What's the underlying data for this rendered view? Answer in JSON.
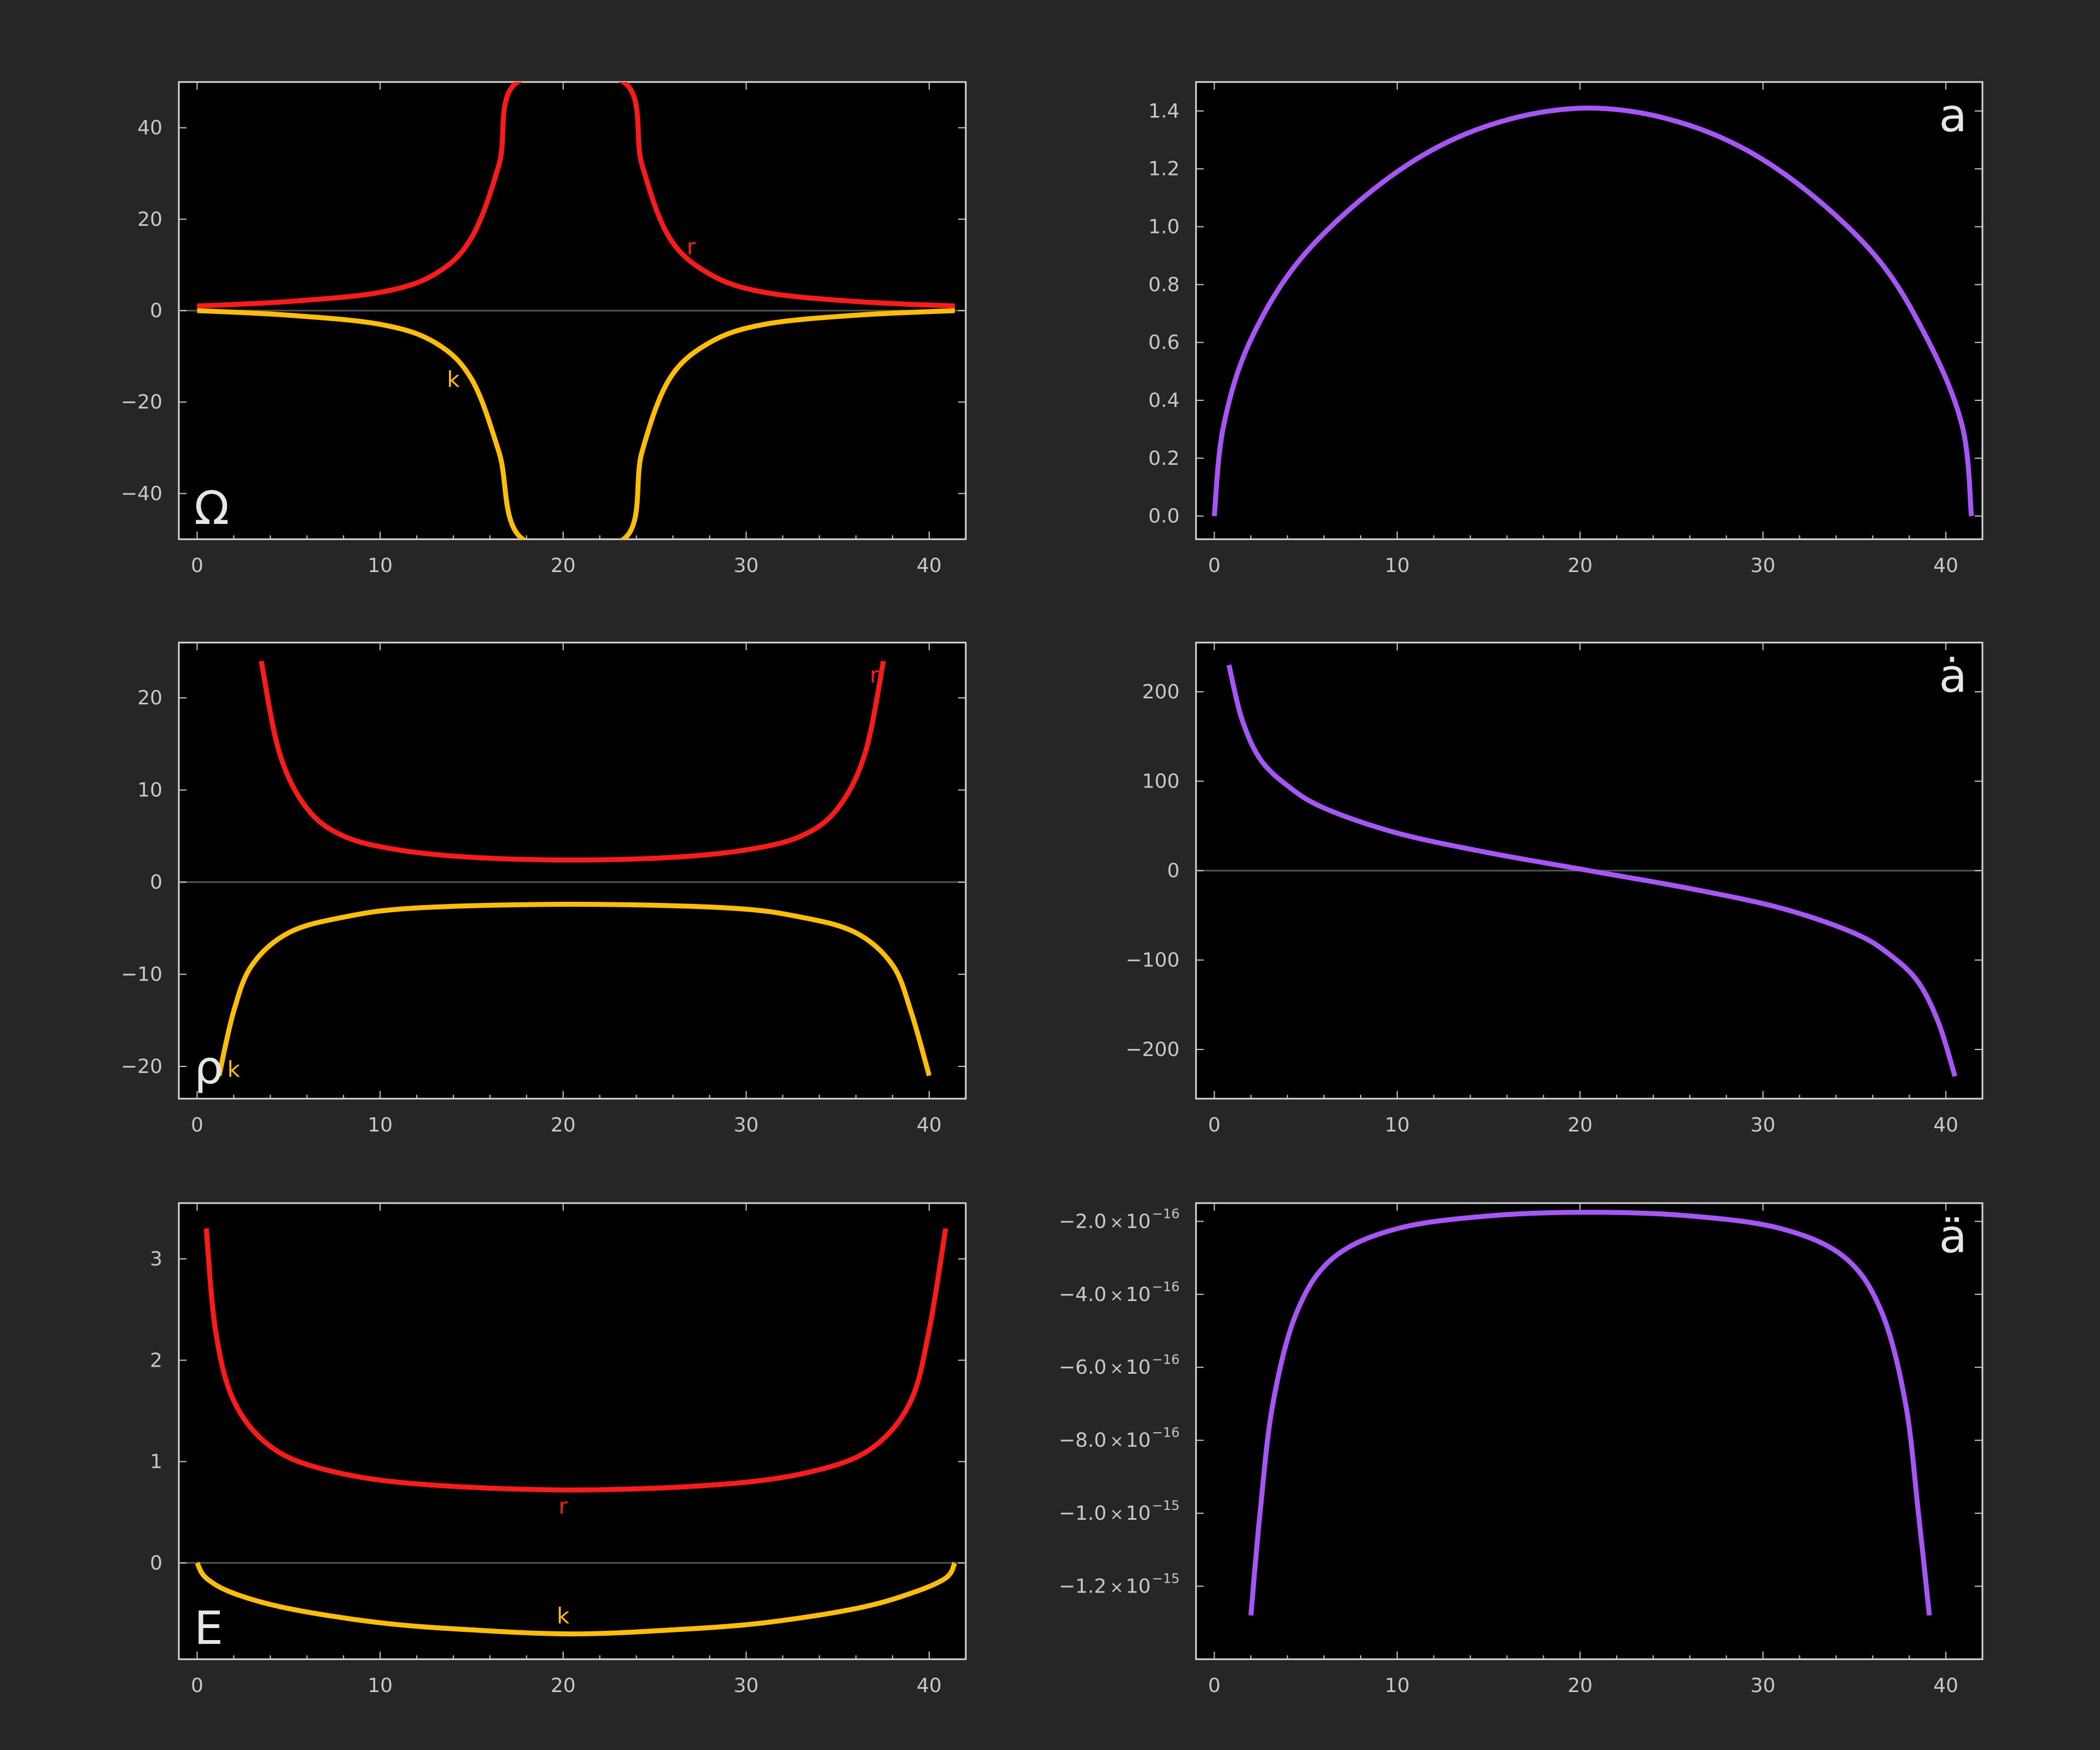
{
  "chart_data": [
    {
      "type": "line",
      "panel_label": "Ω",
      "xlim": [
        -1,
        42
      ],
      "ylim": [
        -50,
        50
      ],
      "x_ticks": [
        0,
        10,
        20,
        30,
        40
      ],
      "y_ticks": [
        40,
        20,
        0,
        -20,
        -40
      ],
      "y_tick_labels": [
        "40",
        "20",
        "0",
        "−20",
        "−40"
      ],
      "zero_line": true,
      "series": [
        {
          "name": "r",
          "color": "#ff1a1a",
          "x": [
            0,
            5,
            10,
            13,
            15,
            16.5,
            17.5,
            23.3,
            24.3,
            25.8,
            28,
            31,
            36,
            41.4
          ],
          "y": [
            1.0,
            2.0,
            4.0,
            8.0,
            16.0,
            32.0,
            50.0,
            50.0,
            32.0,
            16.0,
            8.0,
            4.0,
            2.0,
            1.0
          ]
        },
        {
          "name": "k",
          "color": "#ffbf00",
          "x": [
            0,
            5,
            10,
            13,
            15,
            16.5,
            17.8,
            23.3,
            24.3,
            25.8,
            28,
            31,
            36,
            41.4
          ],
          "y": [
            0,
            -1.0,
            -3.0,
            -7.0,
            -15.0,
            -31.0,
            -50.0,
            -50.0,
            -31.0,
            -15.0,
            -7.0,
            -3.0,
            -1.0,
            0
          ]
        }
      ],
      "annotations": [
        {
          "text": "r",
          "series": "r",
          "x": 27,
          "y": 14
        },
        {
          "text": "k",
          "series": "k",
          "x": 14,
          "y": -15
        }
      ]
    },
    {
      "type": "line",
      "panel_label": "a",
      "xlim": [
        -1,
        42
      ],
      "ylim": [
        -0.08,
        1.5
      ],
      "x_ticks": [
        0,
        10,
        20,
        30,
        40
      ],
      "y_ticks": [
        0,
        0.2,
        0.4,
        0.6,
        0.8,
        1.0,
        1.2,
        1.4
      ],
      "y_tick_labels": [
        "0.0",
        "0.2",
        "0.4",
        "0.6",
        "0.8",
        "1.0",
        "1.2",
        "1.4"
      ],
      "series": [
        {
          "name": "",
          "color": "#a855f7",
          "x": [
            0,
            0.5,
            2,
            5,
            10,
            15,
            20.5,
            26,
            31,
            36,
            39,
            40.9,
            41.4
          ],
          "y": [
            0,
            0.31,
            0.61,
            0.91,
            1.19,
            1.35,
            1.41,
            1.35,
            1.19,
            0.91,
            0.61,
            0.31,
            0
          ]
        }
      ]
    },
    {
      "type": "line",
      "panel_label": "ρ",
      "xlim": [
        -1,
        42
      ],
      "ylim": [
        -23.5,
        26
      ],
      "x_ticks": [
        0,
        10,
        20,
        30,
        40
      ],
      "y_ticks": [
        20,
        10,
        0,
        -10,
        -20
      ],
      "y_tick_labels": [
        "20",
        "10",
        "0",
        "−10",
        "−20"
      ],
      "zero_line": true,
      "series": [
        {
          "name": "r",
          "color": "#ff1a1a",
          "x": [
            3.5,
            4.5,
            6,
            8,
            11,
            15,
            20.5,
            26,
            30,
            33,
            35,
            36.5,
            37.5
          ],
          "y": [
            24,
            14,
            8,
            5,
            3.5,
            2.7,
            2.4,
            2.7,
            3.5,
            5,
            8,
            14,
            24
          ]
        },
        {
          "name": "k",
          "color": "#ffbf00",
          "x": [
            1.2,
            2,
            3,
            5,
            8,
            12,
            20.5,
            29,
            33,
            36,
            38,
            39,
            40
          ],
          "y": [
            -21,
            -14,
            -9,
            -5.5,
            -3.8,
            -2.8,
            -2.4,
            -2.8,
            -3.8,
            -5.5,
            -9,
            -14,
            -21
          ]
        }
      ],
      "annotations": [
        {
          "text": "r",
          "series": "r",
          "x": 37,
          "y": 22.5
        },
        {
          "text": "k",
          "series": "k",
          "x": 2,
          "y": -20.3
        }
      ]
    },
    {
      "type": "line",
      "panel_label": "ȧ",
      "xlim": [
        -1,
        42
      ],
      "ylim": [
        -255,
        255
      ],
      "x_ticks": [
        0,
        10,
        20,
        30,
        40
      ],
      "y_ticks": [
        200,
        100,
        0,
        -100,
        -200
      ],
      "y_tick_labels": [
        "200",
        "100",
        "0",
        "−100",
        "−200"
      ],
      "zero_line": true,
      "series": [
        {
          "name": "",
          "color": "#a855f7",
          "x": [
            0.8,
            1.5,
            2.5,
            4,
            6,
            10,
            15,
            20.5,
            26,
            31,
            35,
            37,
            38.5,
            39.6,
            40.5
          ],
          "y": [
            230,
            170,
            125,
            95,
            70,
            42,
            20,
            0,
            -20,
            -42,
            -70,
            -95,
            -125,
            -170,
            -230
          ]
        }
      ]
    },
    {
      "type": "line",
      "panel_label": "E",
      "xlim": [
        -1,
        42
      ],
      "ylim": [
        -0.95,
        3.55
      ],
      "x_ticks": [
        0,
        10,
        20,
        30,
        40
      ],
      "y_ticks": [
        3,
        2,
        1,
        0
      ],
      "y_tick_labels": [
        "3",
        "2",
        "1",
        "0"
      ],
      "zero_line": true,
      "series": [
        {
          "name": "r",
          "color": "#ff1a1a",
          "x": [
            0.5,
            1,
            2,
            4,
            7,
            12,
            20.5,
            29,
            34,
            37,
            39,
            40,
            40.9
          ],
          "y": [
            3.3,
            2.3,
            1.6,
            1.15,
            0.92,
            0.78,
            0.72,
            0.78,
            0.92,
            1.15,
            1.6,
            2.3,
            3.3
          ]
        },
        {
          "name": "k",
          "color": "#ffbf00",
          "x": [
            0,
            0.5,
            2,
            5,
            10,
            15,
            20.5,
            26,
            31,
            36,
            39,
            40.9,
            41.4
          ],
          "y": [
            0,
            -0.15,
            -0.3,
            -0.45,
            -0.59,
            -0.66,
            -0.7,
            -0.66,
            -0.59,
            -0.45,
            -0.3,
            -0.15,
            0
          ]
        }
      ],
      "annotations": [
        {
          "text": "r",
          "series": "r",
          "x": 20,
          "y": 0.56
        },
        {
          "text": "k",
          "series": "k",
          "x": 20,
          "y": -0.52
        }
      ]
    },
    {
      "type": "line",
      "panel_label": "ä",
      "xlim": [
        -1,
        42
      ],
      "ylim": [
        -1.4e-15,
        -1.5e-16
      ],
      "x_ticks": [
        0,
        10,
        20,
        30,
        40
      ],
      "y_ticks": [
        -2e-16,
        -4e-16,
        -6e-16,
        -8e-16,
        -1e-15,
        -1.2e-15
      ],
      "y_tick_labels": [
        {
          "mantissa": "−2.0",
          "times": "×",
          "base": "10",
          "exponent": "−16"
        },
        {
          "mantissa": "−4.0",
          "times": "×",
          "base": "10",
          "exponent": "−16"
        },
        {
          "mantissa": "−6.0",
          "times": "×",
          "base": "10",
          "exponent": "−16"
        },
        {
          "mantissa": "−8.0",
          "times": "×",
          "base": "10",
          "exponent": "−16"
        },
        {
          "mantissa": "−1.0",
          "times": "×",
          "base": "10",
          "exponent": "−15"
        },
        {
          "mantissa": "−1.2",
          "times": "×",
          "base": "10",
          "exponent": "−15"
        }
      ],
      "series": [
        {
          "name": "",
          "color": "#a855f7",
          "x": [
            2,
            2.5,
            3.2,
            4.5,
            6.5,
            10,
            15,
            20.5,
            26,
            31,
            34.5,
            36.5,
            37.8,
            38.5,
            39.1
          ],
          "y": [
            -1.28e-15,
            -1e-15,
            -7e-16,
            -4.5e-16,
            -3e-16,
            -2.2e-16,
            -1.85e-16,
            -1.75e-16,
            -1.85e-16,
            -2.2e-16,
            -3e-16,
            -4.5e-16,
            -7e-16,
            -1e-15,
            -1.28e-15
          ]
        }
      ]
    }
  ]
}
